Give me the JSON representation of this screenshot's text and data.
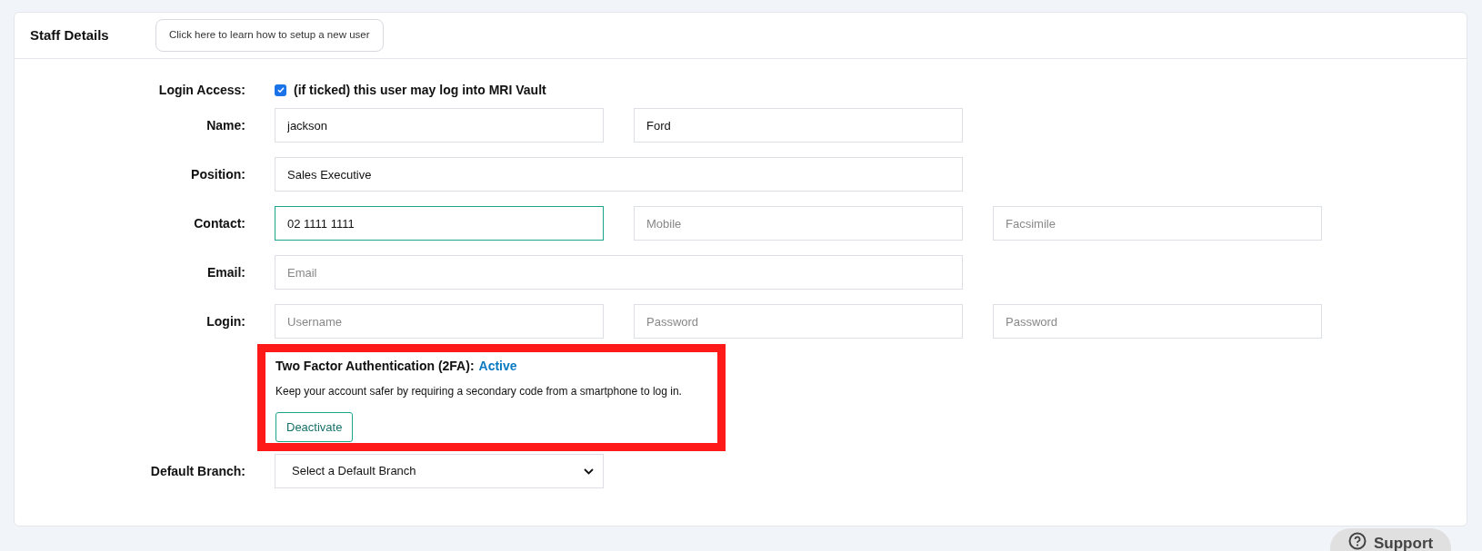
{
  "header": {
    "title": "Staff Details",
    "help_button": "Click here to learn how to setup a new user"
  },
  "login_access": {
    "label": "Login Access:",
    "checked": true,
    "text": "(if ticked) this user may log into MRI Vault"
  },
  "rows": [
    {
      "label": "Name:",
      "fields": [
        {
          "kind": "short",
          "value": "jackson",
          "focused": false
        },
        {
          "kind": "short",
          "value": "Ford",
          "focused": false
        }
      ]
    },
    {
      "label": "Position:",
      "fields": [
        {
          "kind": "wide",
          "value": "Sales Executive",
          "focused": false
        }
      ]
    },
    {
      "label": "Contact:",
      "fields": [
        {
          "kind": "short",
          "value": "02 1111 1111",
          "focused": true
        },
        {
          "kind": "short",
          "placeholder": "Mobile",
          "focused": false
        },
        {
          "kind": "short",
          "placeholder": "Facsimile",
          "focused": false
        }
      ]
    },
    {
      "label": "Email:",
      "fields": [
        {
          "kind": "wide",
          "placeholder": "Email",
          "focused": false
        }
      ]
    },
    {
      "label": "Login:",
      "fields": [
        {
          "kind": "short",
          "placeholder": "Username",
          "focused": false
        },
        {
          "kind": "short",
          "placeholder": "Password",
          "focused": false
        },
        {
          "kind": "short",
          "placeholder": "Password",
          "focused": false
        }
      ]
    }
  ],
  "two_factor": {
    "title": "Two Factor Authentication (2FA):",
    "status": "Active",
    "description": "Keep your account safer by requiring a secondary code from a smartphone to log in.",
    "button": "Deactivate"
  },
  "default_branch": {
    "label": "Default Branch:",
    "value": "Select a Default Branch"
  },
  "support_button": {
    "label": "Support"
  }
}
